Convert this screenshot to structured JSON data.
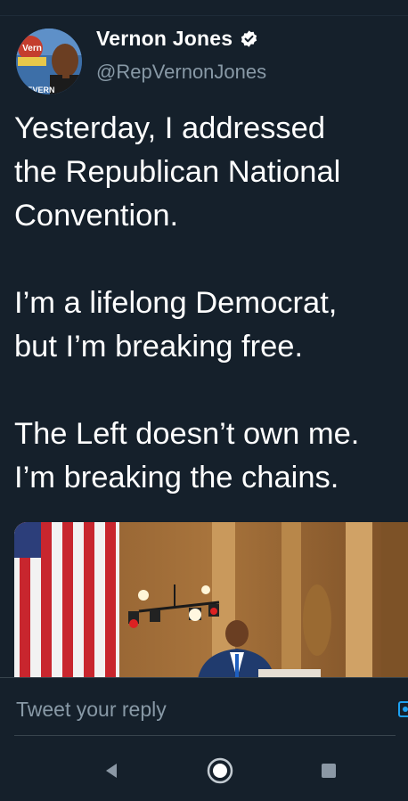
{
  "author": {
    "display_name": "Vernon Jones",
    "handle": "@RepVernonJones",
    "avatar_text_top": "Vern",
    "avatar_text_bottom": "THEVERN"
  },
  "tweet": {
    "lines": [
      "Yesterday, I addressed",
      "the Republican National",
      "Convention.",
      "",
      "I’m a lifelong Democrat,",
      "but I’m breaking free.",
      "",
      "The Left doesn’t own me.",
      "I’m breaking the chains."
    ]
  },
  "reply": {
    "placeholder": "Tweet your reply"
  },
  "nav": {
    "back_icon": "back-triangle-icon",
    "home_icon": "home-circle-icon",
    "recents_icon": "recents-square-icon"
  },
  "colors": {
    "background": "#15202b",
    "text": "#ffffff",
    "secondary": "#8899a6",
    "accent": "#1da1f2"
  }
}
